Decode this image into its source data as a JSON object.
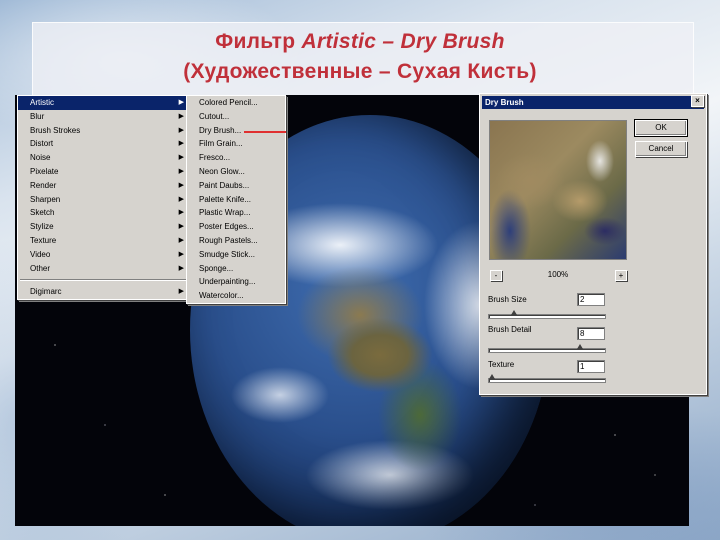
{
  "slide": {
    "title_prefix": "Фильтр ",
    "title_italic": "Artistic – Dry Brush",
    "title_line2": "(Художественные – Сухая Кисть)"
  },
  "filter_menu": {
    "items": [
      {
        "label": "Artistic",
        "submenu": true,
        "selected": true
      },
      {
        "label": "Blur",
        "submenu": true
      },
      {
        "label": "Brush Strokes",
        "submenu": true
      },
      {
        "label": "Distort",
        "submenu": true
      },
      {
        "label": "Noise",
        "submenu": true
      },
      {
        "label": "Pixelate",
        "submenu": true
      },
      {
        "label": "Render",
        "submenu": true
      },
      {
        "label": "Sharpen",
        "submenu": true
      },
      {
        "label": "Sketch",
        "submenu": true
      },
      {
        "label": "Stylize",
        "submenu": true
      },
      {
        "label": "Texture",
        "submenu": true
      },
      {
        "label": "Video",
        "submenu": true
      },
      {
        "label": "Other",
        "submenu": true
      }
    ],
    "extra_item": {
      "label": "Digimarc",
      "submenu": true
    }
  },
  "artistic_submenu": {
    "items": [
      "Colored Pencil...",
      "Cutout...",
      "Dry Brush...",
      "Film Grain...",
      "Fresco...",
      "Neon Glow...",
      "Paint Daubs...",
      "Palette Knife...",
      "Plastic Wrap...",
      "Poster Edges...",
      "Rough Pastels...",
      "Smudge Stick...",
      "Sponge...",
      "Underpainting...",
      "Watercolor..."
    ]
  },
  "dialog": {
    "title": "Dry Brush",
    "close_glyph": "×",
    "ok_label": "OK",
    "cancel_label": "Cancel",
    "zoom_out_glyph": "-",
    "zoom_in_glyph": "+",
    "zoom_level": "100%",
    "params": [
      {
        "label": "Brush Size",
        "value": "2",
        "slider_fraction": 0.2
      },
      {
        "label": "Brush Detail",
        "value": "8",
        "slider_fraction": 0.8
      },
      {
        "label": "Texture",
        "value": "1",
        "slider_fraction": 0.0
      }
    ]
  },
  "colors": {
    "title": "#c0303a",
    "menu_highlight": "#0a246a",
    "pointer_line": "#e03030"
  }
}
